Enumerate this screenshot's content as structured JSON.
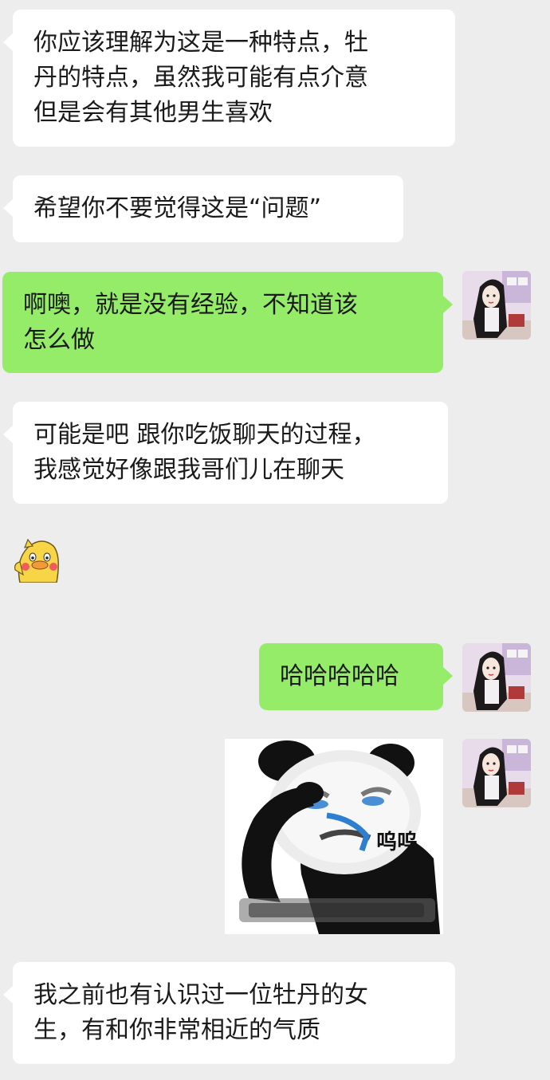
{
  "messages": [
    {
      "side": "left",
      "kind": "text",
      "text": "你应该理解为这是一种特点，牡\n丹的特点，虽然我可能有点介意\n但是会有其他男生喜欢"
    },
    {
      "side": "left",
      "kind": "text",
      "text": "希望你不要觉得这是“问题”"
    },
    {
      "side": "right",
      "kind": "text",
      "text": "啊噢，就是没有经验，不知道该\n怎么做"
    },
    {
      "side": "left",
      "kind": "text",
      "text": "可能是吧 跟你吃饭聊天的过程，\n我感觉好像跟我哥们儿在聊天"
    },
    {
      "side": "left",
      "kind": "sticker",
      "icon": "duck-sticker-icon"
    },
    {
      "side": "right",
      "kind": "text",
      "text": "哈哈哈哈哈"
    },
    {
      "side": "right",
      "kind": "sticker",
      "icon": "crying-panda-meme-icon",
      "caption": "呜呜"
    },
    {
      "side": "left",
      "kind": "text",
      "text": "我之前也有认识过一位牡丹的女\n生，有和你非常相近的气质"
    }
  ],
  "colors": {
    "background": "#ededed",
    "incoming_bubble": "#ffffff",
    "outgoing_bubble": "#95ec69"
  }
}
